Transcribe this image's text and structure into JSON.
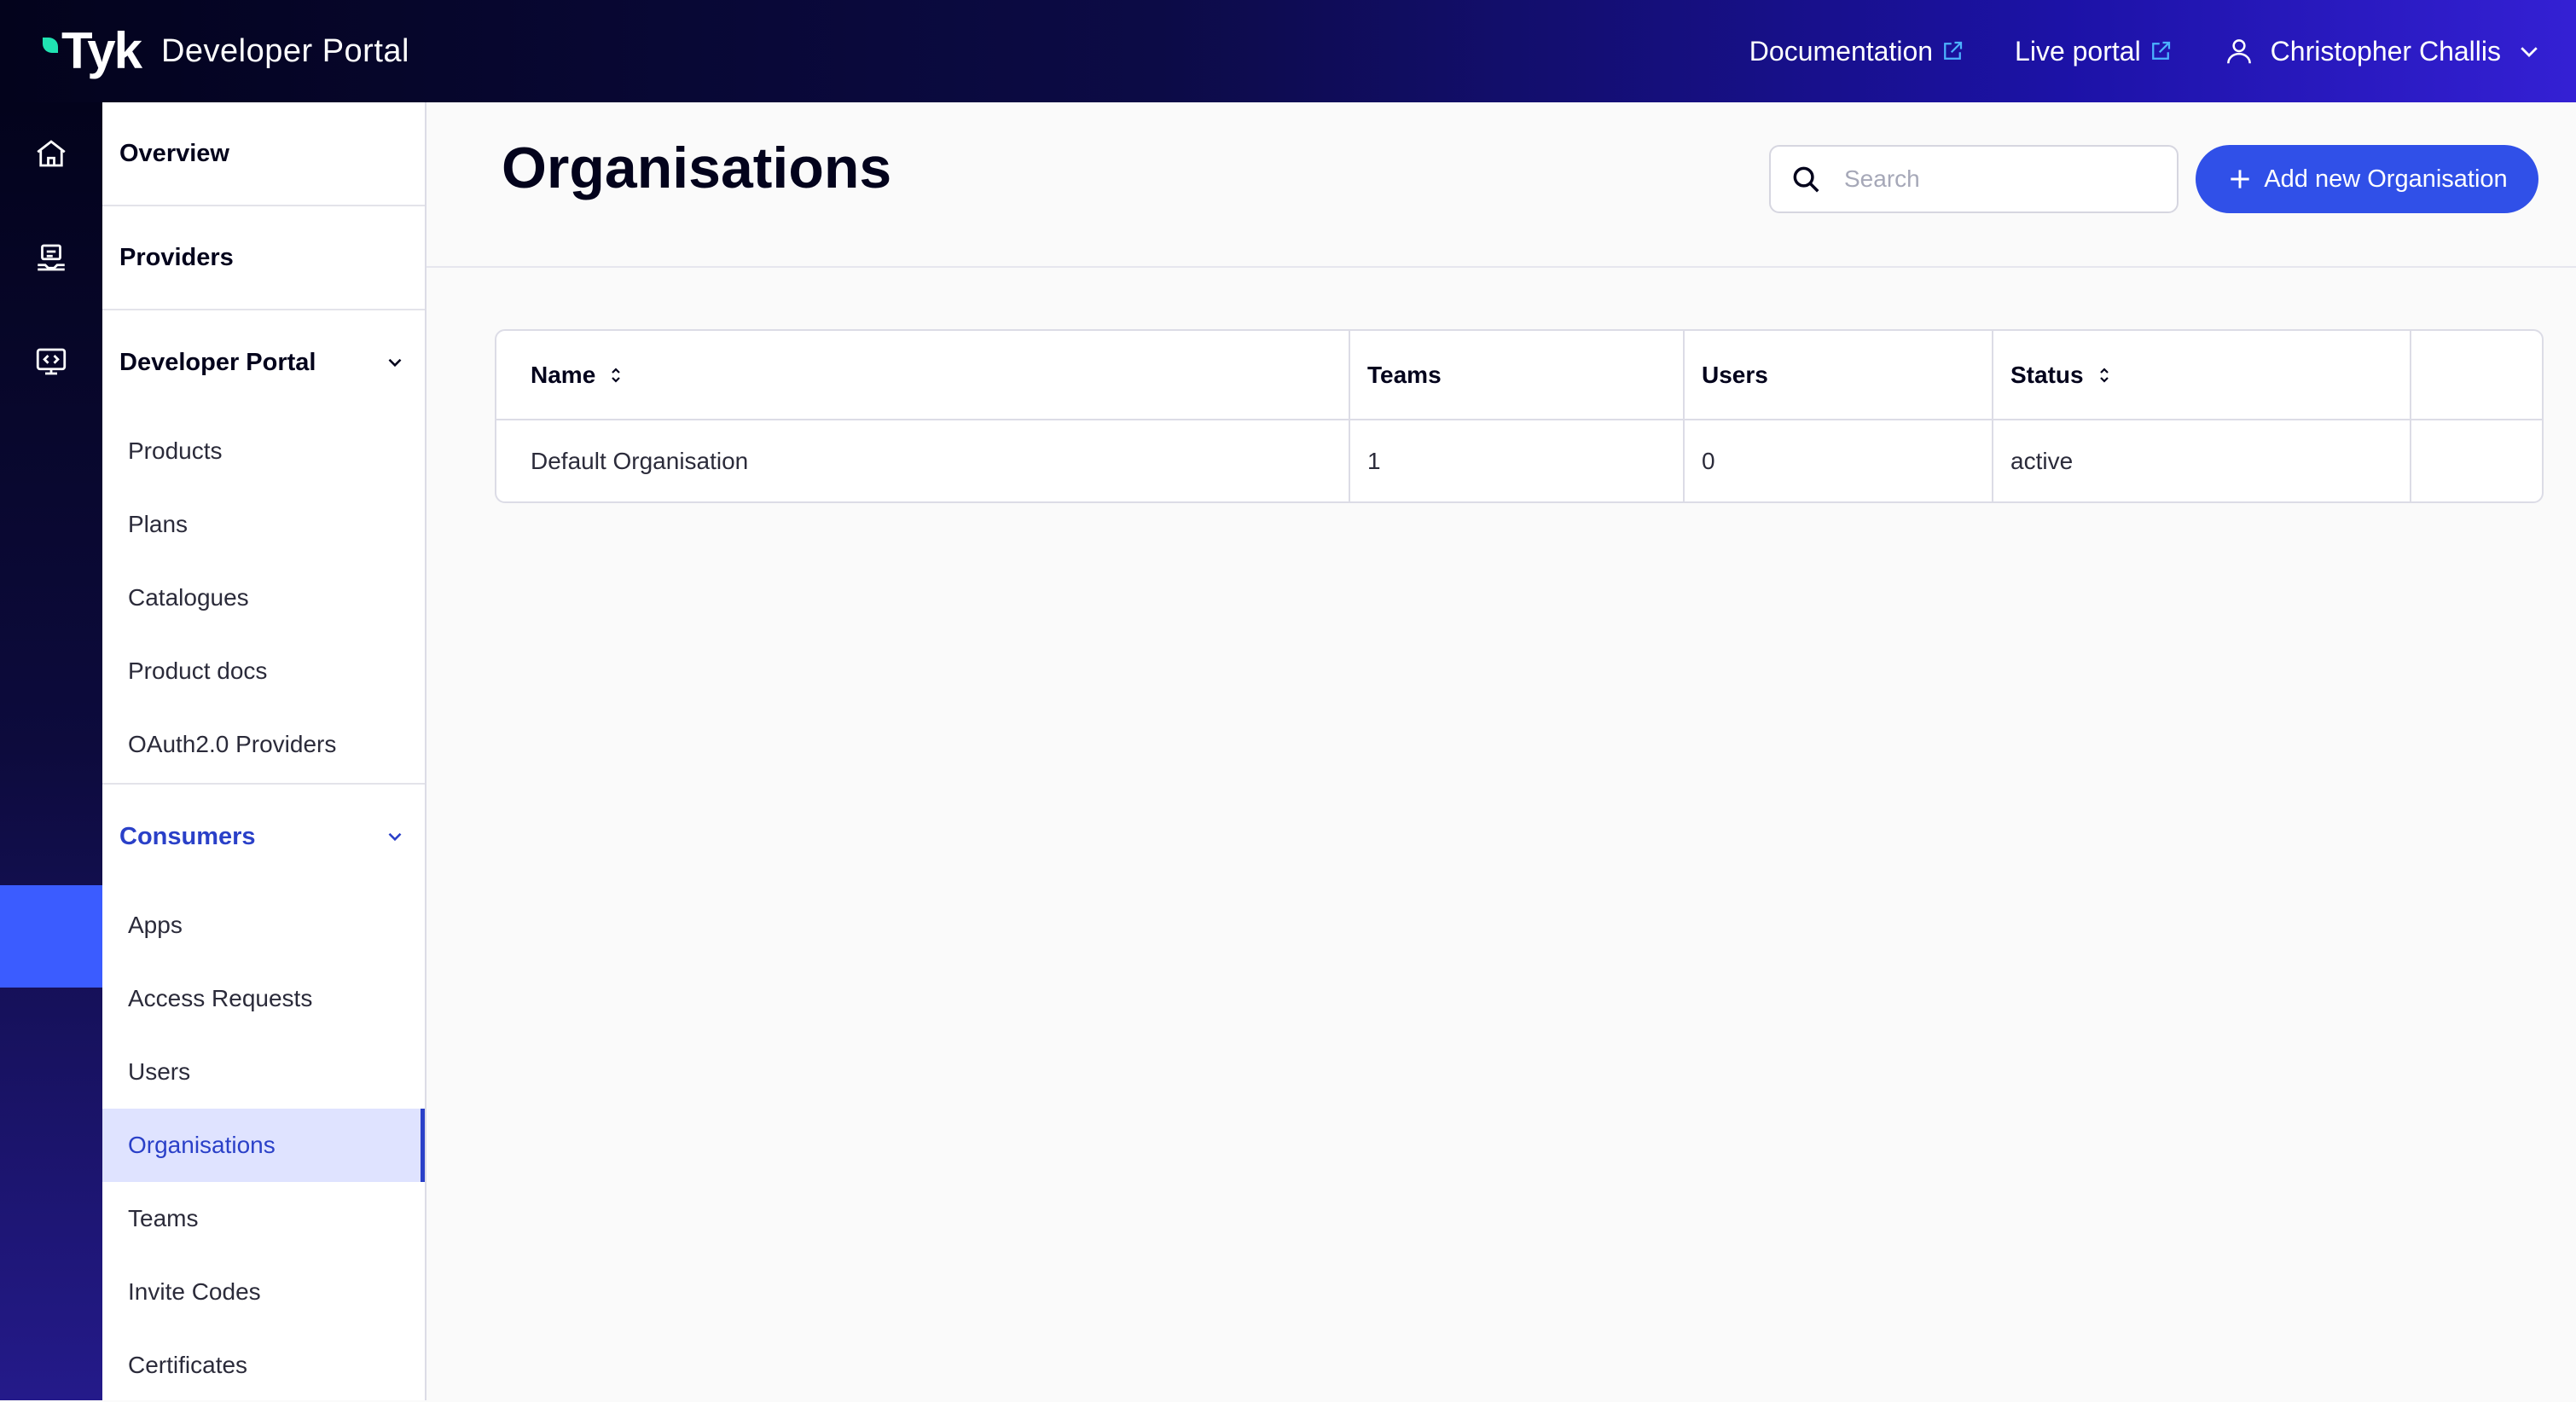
{
  "app": {
    "brand_logo": "Tyk",
    "brand_sub": "Developer Portal"
  },
  "topbar": {
    "documentation": "Documentation",
    "live_portal": "Live portal",
    "user_name": "Christopher Challis"
  },
  "sidenav": {
    "overview": "Overview",
    "providers": "Providers",
    "developer_portal": "Developer Portal",
    "developer_portal_items": [
      "Products",
      "Plans",
      "Catalogues",
      "Product docs",
      "OAuth2.0 Providers"
    ],
    "consumers": "Consumers",
    "consumers_items": [
      "Apps",
      "Access Requests",
      "Users",
      "Organisations",
      "Teams",
      "Invite Codes",
      "Certificates"
    ],
    "active_item": "Organisations"
  },
  "page": {
    "title": "Organisations",
    "search_placeholder": "Search",
    "add_button": "Add new Organisation"
  },
  "table": {
    "headers": [
      "Name",
      "Teams",
      "Users",
      "Status",
      ""
    ],
    "rows": [
      [
        "Default Organisation",
        "1",
        "0",
        "active",
        ""
      ]
    ]
  },
  "colors": {
    "accent": "#3050e8",
    "active_nav_bg": "#dfe3ff",
    "active_nav_text": "#2a40c8",
    "external_link_icon": "#4cb3ff"
  },
  "icons": {
    "rail": [
      "home-icon",
      "providers-icon",
      "developer-portal-icon",
      "consumers-icon"
    ]
  }
}
